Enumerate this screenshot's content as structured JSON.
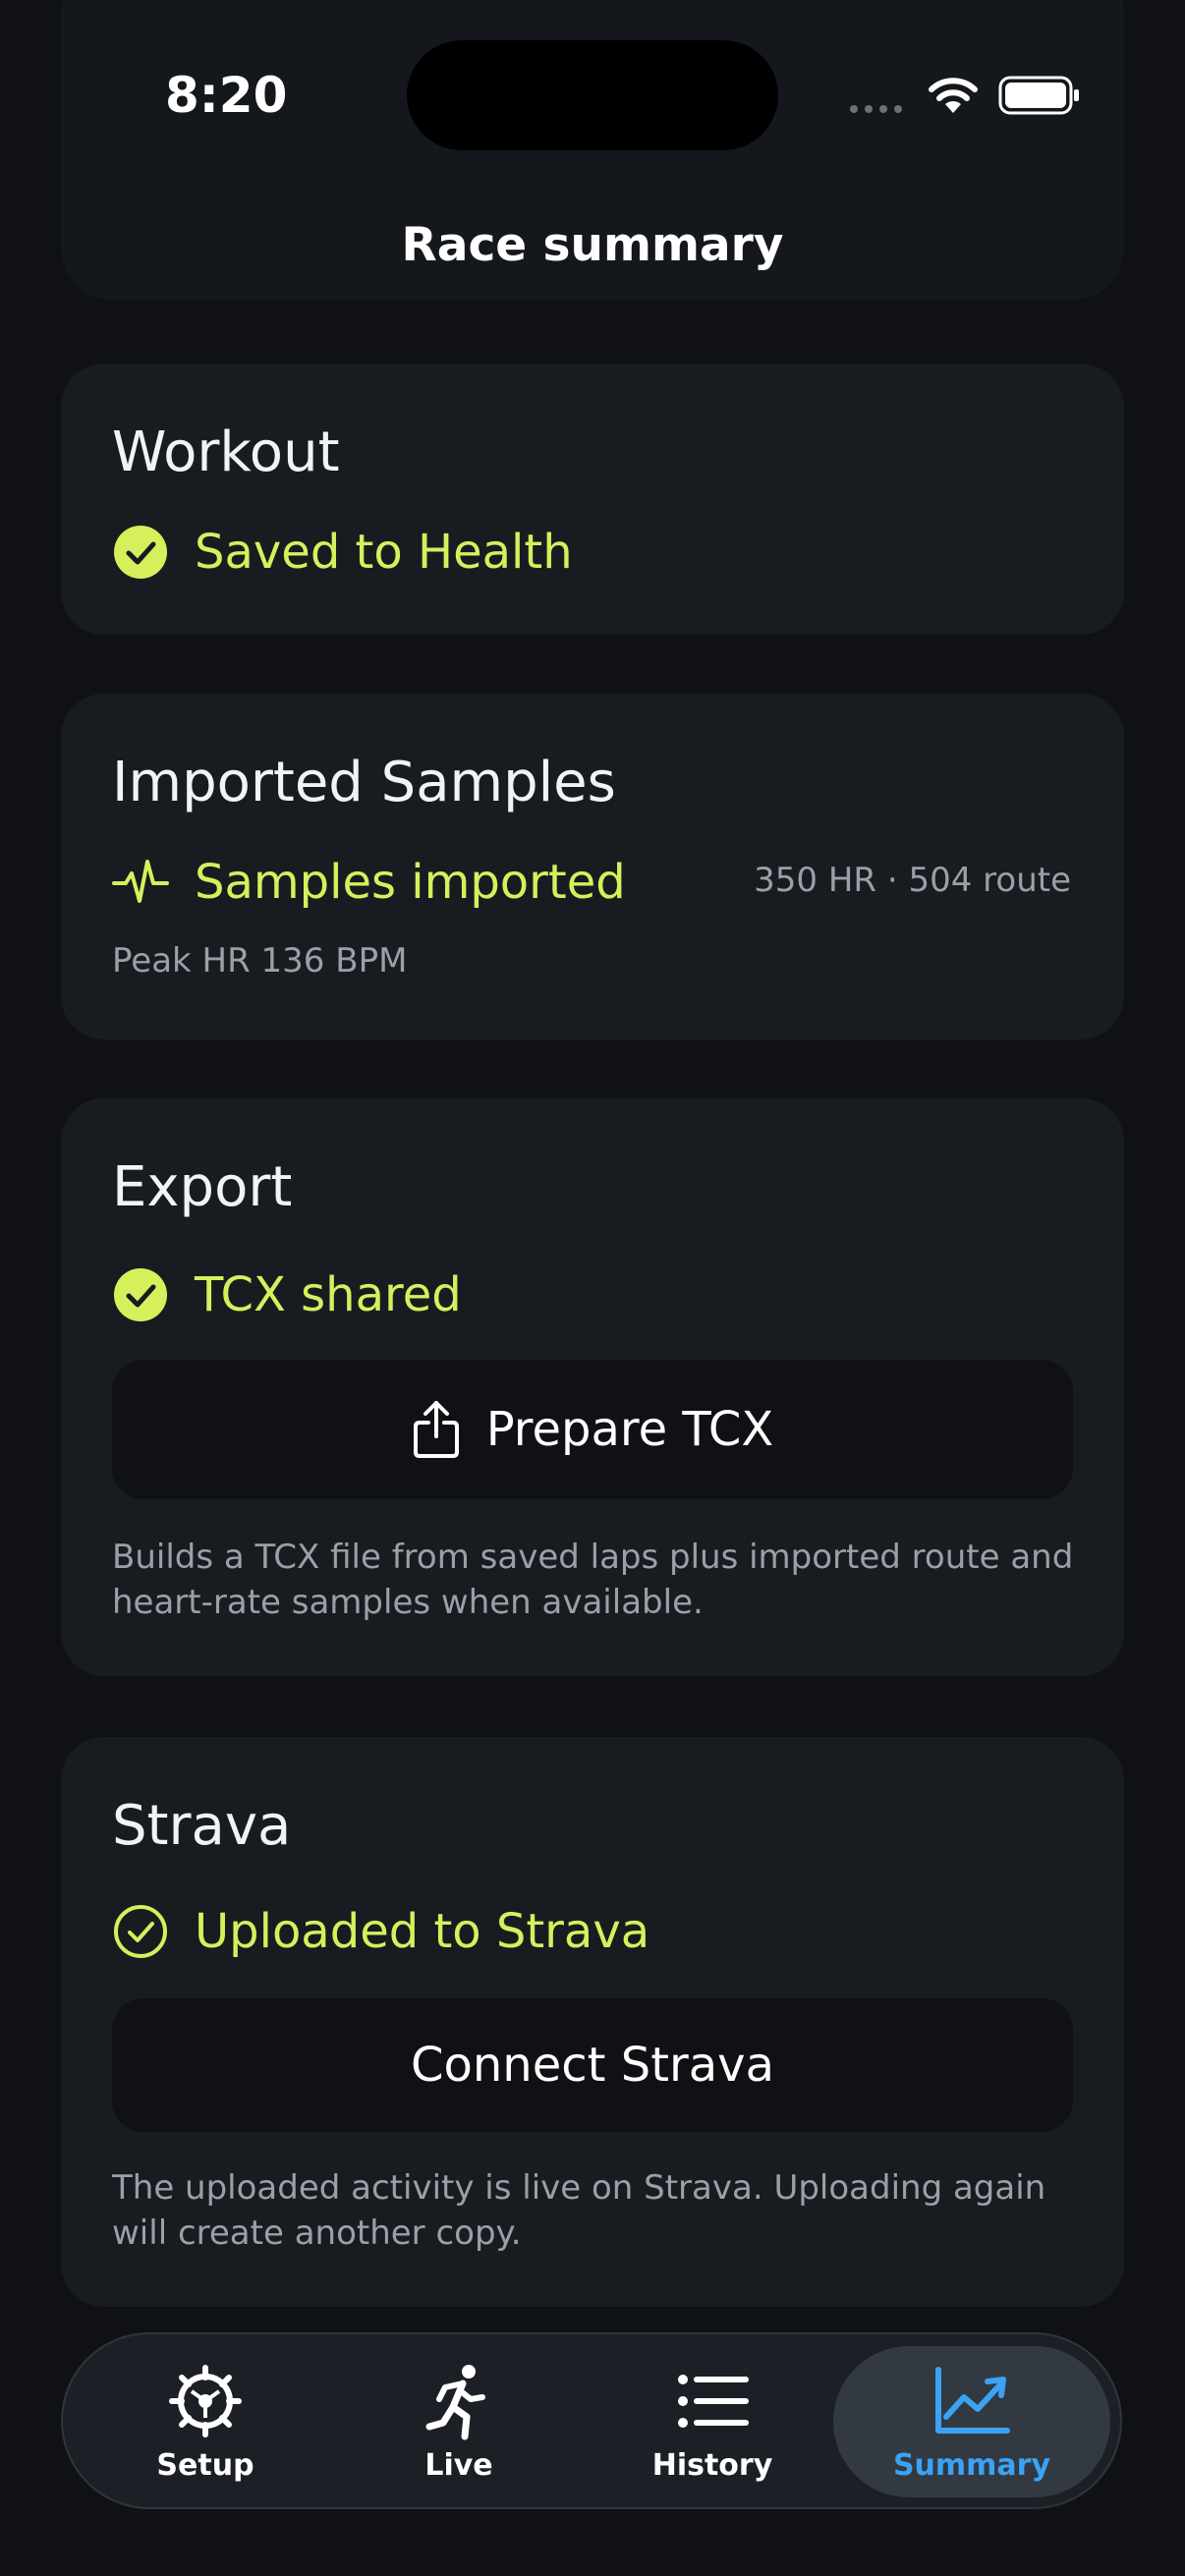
{
  "status_bar": {
    "time": "8:20"
  },
  "nav": {
    "title": "Race summary"
  },
  "workout": {
    "title": "Workout",
    "status": "Saved to Health",
    "status_icon": "check-circle-filled-icon"
  },
  "samples": {
    "title": "Imported Samples",
    "status": "Samples imported",
    "status_icon": "heartbeat-icon",
    "counts": "350 HR · 504 route",
    "peak_hr": "Peak HR 136 BPM"
  },
  "export": {
    "title": "Export",
    "status": "TCX shared",
    "status_icon": "check-circle-filled-icon",
    "button_label": "Prepare TCX",
    "button_icon": "share-icon",
    "help": "Builds a TCX file from saved laps plus imported route and heart-rate samples when available."
  },
  "strava": {
    "title": "Strava",
    "status": "Uploaded to Strava",
    "status_icon": "check-circle-outline-icon",
    "button_label": "Connect Strava",
    "help": "The uploaded activity is live on Strava. Uploading again will create another copy."
  },
  "tabs": [
    {
      "label": "Setup",
      "icon": "gear-icon",
      "active": false
    },
    {
      "label": "Live",
      "icon": "runner-icon",
      "active": false
    },
    {
      "label": "History",
      "icon": "list-icon",
      "active": false
    },
    {
      "label": "Summary",
      "icon": "chart-trend-icon",
      "active": true
    }
  ],
  "colors": {
    "background": "#0f1114",
    "card": "#181c21",
    "accent_lime": "#d6f05c",
    "accent_blue": "#3aa3f5",
    "secondary_text": "#9aa0a8"
  }
}
